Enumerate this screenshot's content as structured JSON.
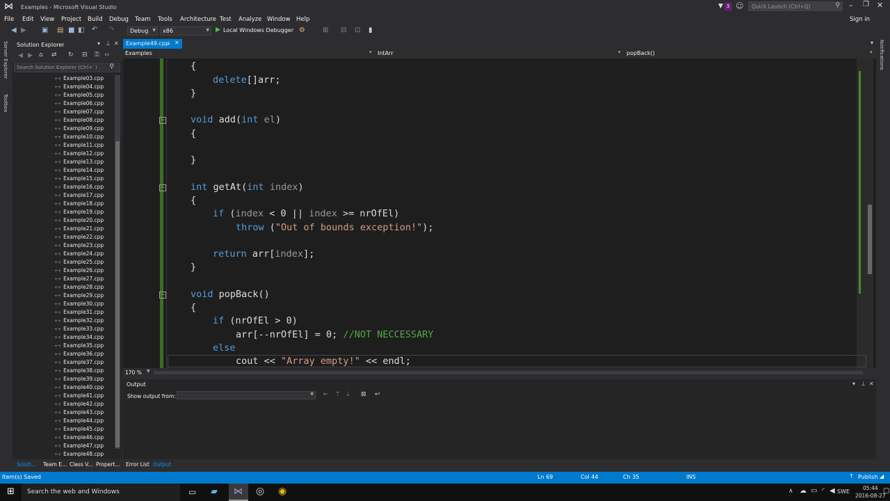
{
  "window": {
    "title": "Examples - Microsoft Visual Studio",
    "quick_launch": "Quick Launch (Ctrl+Q)",
    "sign_in": "Sign in",
    "notif": "3"
  },
  "menu": [
    "File",
    "Edit",
    "View",
    "Project",
    "Build",
    "Debug",
    "Team",
    "Tools",
    "Architecture",
    "Test",
    "Analyze",
    "Window",
    "Help"
  ],
  "toolbar": {
    "config": "Debug",
    "platform": "x86",
    "run": "Local Windows Debugger"
  },
  "left_strip": [
    "Server Explorer",
    "Toolbox"
  ],
  "right_strip": "Notifications",
  "solution_explorer": {
    "title": "Solution Explorer",
    "search": "Search Solution Explorer (Ctrl+`)",
    "items": [
      "Example03.cpp",
      "Example04.cpp",
      "Example05.cpp",
      "Example06.cpp",
      "Example07.cpp",
      "Example08.cpp",
      "Example09.cpp",
      "Example10.cpp",
      "Example11.cpp",
      "Example12.cpp",
      "Example13.cpp",
      "Example14.cpp",
      "Example15.cpp",
      "Example16.cpp",
      "Example17.cpp",
      "Example18.cpp",
      "Example19.cpp",
      "Example20.cpp",
      "Example21.cpp",
      "Example22.cpp",
      "Example23.cpp",
      "Example24.cpp",
      "Example25.cpp",
      "Example26.cpp",
      "Example27.cpp",
      "Example28.cpp",
      "Example29.cpp",
      "Example30.cpp",
      "Example31.cpp",
      "Example32.cpp",
      "Example33.cpp",
      "Example34.cpp",
      "Example35.cpp",
      "Example36.cpp",
      "Example37.cpp",
      "Example38.cpp",
      "Example39.cpp",
      "Example40.cpp",
      "Example41.cpp",
      "Example42.cpp",
      "Example43.cpp",
      "Example44.cpp",
      "Example45.cpp",
      "Example46.cpp",
      "Example47.cpp",
      "Example48.cpp"
    ],
    "bottom_tabs": [
      "Soluti...",
      "Team E...",
      "Class V...",
      "Propert..."
    ]
  },
  "editor": {
    "tab": "Example49.cpp",
    "nav_project": "Examples",
    "nav_class": "IntArr",
    "nav_member": "popBack()",
    "zoom": "170 %"
  },
  "code": {
    "l1": "{",
    "l2_a": "delete",
    "l2_b": "[]arr;",
    "l3": "}",
    "l4_kw": "void",
    "l4_rest": " add(",
    "l4_kw2": "int",
    "l4_par": " el",
    "l4_end": ")",
    "l5": "{",
    "l6": "}",
    "l7_kw": "int",
    "l7_rest": " getAt(",
    "l7_kw2": "int",
    "l7_par": " index",
    "l7_end": ")",
    "l8": "{",
    "l9_kw": "if",
    "l9_a": " (",
    "l9_par": "index",
    "l9_b": " < 0 || ",
    "l9_par2": "index",
    "l9_c": " >= nrOfEl)",
    "l10_kw": "throw",
    "l10_a": " (",
    "l10_str": "\"Out of bounds exception!\"",
    "l10_b": ");",
    "l11_kw": "return",
    "l11_a": " arr[",
    "l11_par": "index",
    "l11_b": "];",
    "l12": "}",
    "l13_kw": "void",
    "l13_rest": " popBack()",
    "l14": "{",
    "l15_kw": "if",
    "l15_rest": " (nrOfEl > 0)",
    "l16_a": "arr[--nrOfEl] = 0; ",
    "l16_cmt": "//NOT NECCESSARY",
    "l17_kw": "else",
    "l18_a": "cout << ",
    "l18_str": "\"Array empty!\"",
    "l18_b": " << endl;"
  },
  "output": {
    "title": "Output",
    "show_from": "Show output from:"
  },
  "bottom_tabs": [
    "Error List",
    "Output"
  ],
  "status": {
    "msg": "Item(s) Saved",
    "ln": "Ln 69",
    "col": "Col 44",
    "ch": "Ch 35",
    "ins": "INS",
    "publish": "Publish"
  },
  "taskbar": {
    "search": "Search the web and Windows",
    "lang": "SWE",
    "time": "05:44",
    "date": "2016-08-27"
  }
}
